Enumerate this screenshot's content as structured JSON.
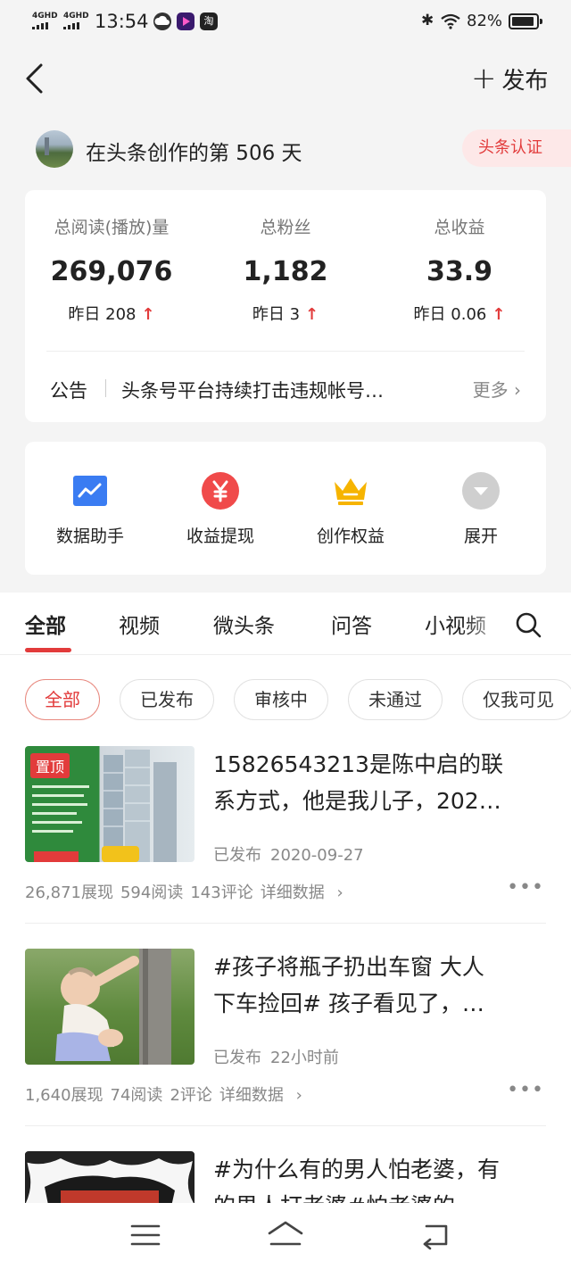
{
  "status_bar": {
    "sim1": "4GHD",
    "sim2": "4GHD",
    "time": "13:54",
    "app_icon_label": "淘",
    "battery": "82%"
  },
  "header": {
    "publish_label": "发布"
  },
  "profile": {
    "text": "在头条创作的第 506 天",
    "verify_label": "头条认证"
  },
  "stats": [
    {
      "label": "总阅读(播放)量",
      "value": "269,076",
      "yesterday": "昨日 208"
    },
    {
      "label": "总粉丝",
      "value": "1,182",
      "yesterday": "昨日 3"
    },
    {
      "label": "总收益",
      "value": "33.9",
      "yesterday": "昨日 0.06"
    }
  ],
  "notice": {
    "label": "公告",
    "text": "头条号平台持续打击违规帐号…",
    "more": "更多"
  },
  "tools": [
    {
      "label": "数据助手",
      "icon": "chart-icon",
      "color": "#3a7cf2"
    },
    {
      "label": "收益提现",
      "icon": "yuan-icon",
      "color": "#f04a4a"
    },
    {
      "label": "创作权益",
      "icon": "crown-icon",
      "color": "#f6b400"
    },
    {
      "label": "展开",
      "icon": "expand-icon",
      "color": "#cfcfcf"
    }
  ],
  "tabs": [
    "全部",
    "视频",
    "微头条",
    "问答",
    "小视频"
  ],
  "chips": [
    "全部",
    "已发布",
    "审核中",
    "未通过",
    "仅我可见"
  ],
  "articles": [
    {
      "title_line1": "15826543213是陈中启的联",
      "title_line2": "系方式，他是我儿子，202…",
      "pin_label": "置顶",
      "status": "已发布",
      "date": "2020-09-27",
      "impressions": "26,871展现",
      "reads": "594阅读",
      "comments": "143评论",
      "detail": "详细数据"
    },
    {
      "title_line1": "#孩子将瓶子扔出车窗 大人",
      "title_line2": "下车捡回# 孩子看见了，…",
      "status": "已发布",
      "date": "22小时前",
      "impressions": "1,640展现",
      "reads": "74阅读",
      "comments": "2评论",
      "detail": "详细数据"
    },
    {
      "title_line1": "#为什么有的男人怕老婆，有",
      "title_line2": "的男人打老婆#怕老婆的"
    }
  ],
  "colors": {
    "accent": "#e23b3b",
    "background": "#f4f4f4"
  }
}
